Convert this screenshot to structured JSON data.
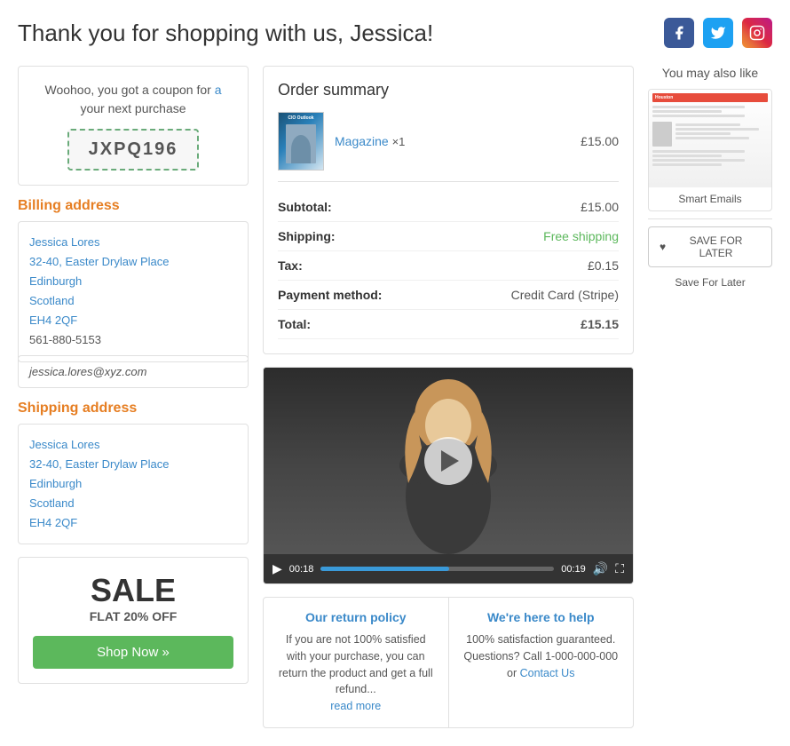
{
  "header": {
    "title": "Thank you for shopping with us, Jessica!",
    "social": {
      "facebook_label": "f",
      "twitter_label": "t",
      "instagram_label": "ig"
    }
  },
  "coupon": {
    "text_line1": "Woohoo, you got a coupon for",
    "text_link": "a",
    "text_line2": "your next purchase",
    "code": "JXPQ196"
  },
  "billing": {
    "title": "Billing address",
    "name": "Jessica Lores",
    "address1": "32-40, Easter Drylaw Place",
    "city": "Edinburgh",
    "region": "Scotland",
    "postcode": "EH4 2QF",
    "phone": "561-880-5153",
    "email": "jessica.lores@xyz.com"
  },
  "shipping": {
    "title": "Shipping address",
    "name": "Jessica Lores",
    "address1": "32-40, Easter Drylaw Place",
    "city": "Edinburgh",
    "region": "Scotland",
    "postcode": "EH4 2QF"
  },
  "sale": {
    "title": "SALE",
    "subtitle": "FLAT 20% OFF",
    "button": "Shop Now »"
  },
  "order_summary": {
    "title": "Order summary",
    "item": {
      "name": "Magazine",
      "quantity": "×1",
      "price": "£15.00"
    },
    "rows": [
      {
        "label": "Subtotal:",
        "value": "£15.00",
        "type": "normal"
      },
      {
        "label": "Shipping:",
        "value": "Free shipping",
        "type": "free"
      },
      {
        "label": "Tax:",
        "value": "£0.15",
        "type": "normal"
      },
      {
        "label": "Payment method:",
        "value": "Credit Card (Stripe)",
        "type": "normal"
      },
      {
        "label": "Total:",
        "value": "£15.15",
        "type": "normal"
      }
    ]
  },
  "video": {
    "time_current": "00:18",
    "time_total": "00:19"
  },
  "return_policy": {
    "title": "Our return policy",
    "text": "If you are not 100% satisfied with your purchase, you can return the product and get a full refund...",
    "read_more": "read more"
  },
  "help": {
    "title": "We're here to help",
    "text": "100% satisfaction guaranteed. Questions? Call 1-000-000-000 or",
    "contact_link": "Contact Us"
  },
  "you_may_like": {
    "title": "You may also like",
    "product_label": "Smart Emails"
  },
  "save_later": {
    "button_label": "SAVE FOR LATER",
    "label": "Save For Later"
  }
}
